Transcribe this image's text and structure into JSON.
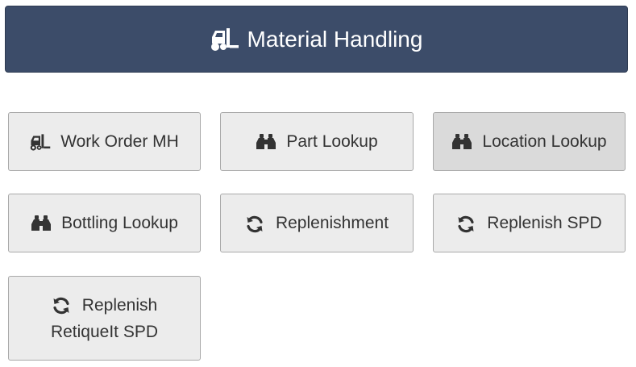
{
  "header": {
    "title": "Material Handling",
    "icon": "forklift-icon",
    "background": "#3c4c69"
  },
  "tiles": [
    {
      "label": "Work Order MH",
      "icon": "forklift-icon"
    },
    {
      "label": "Part Lookup",
      "icon": "binoculars-icon"
    },
    {
      "label": "Location Lookup",
      "icon": "binoculars-icon",
      "state": "hover"
    },
    {
      "label": "Bottling Lookup",
      "icon": "binoculars-icon"
    },
    {
      "label": "Replenishment",
      "icon": "refresh-icon"
    },
    {
      "label": "Replenish SPD",
      "icon": "refresh-icon"
    },
    {
      "label_line1": "Replenish",
      "label_line2": "RetiqueIt SPD",
      "icon": "refresh-icon"
    }
  ]
}
